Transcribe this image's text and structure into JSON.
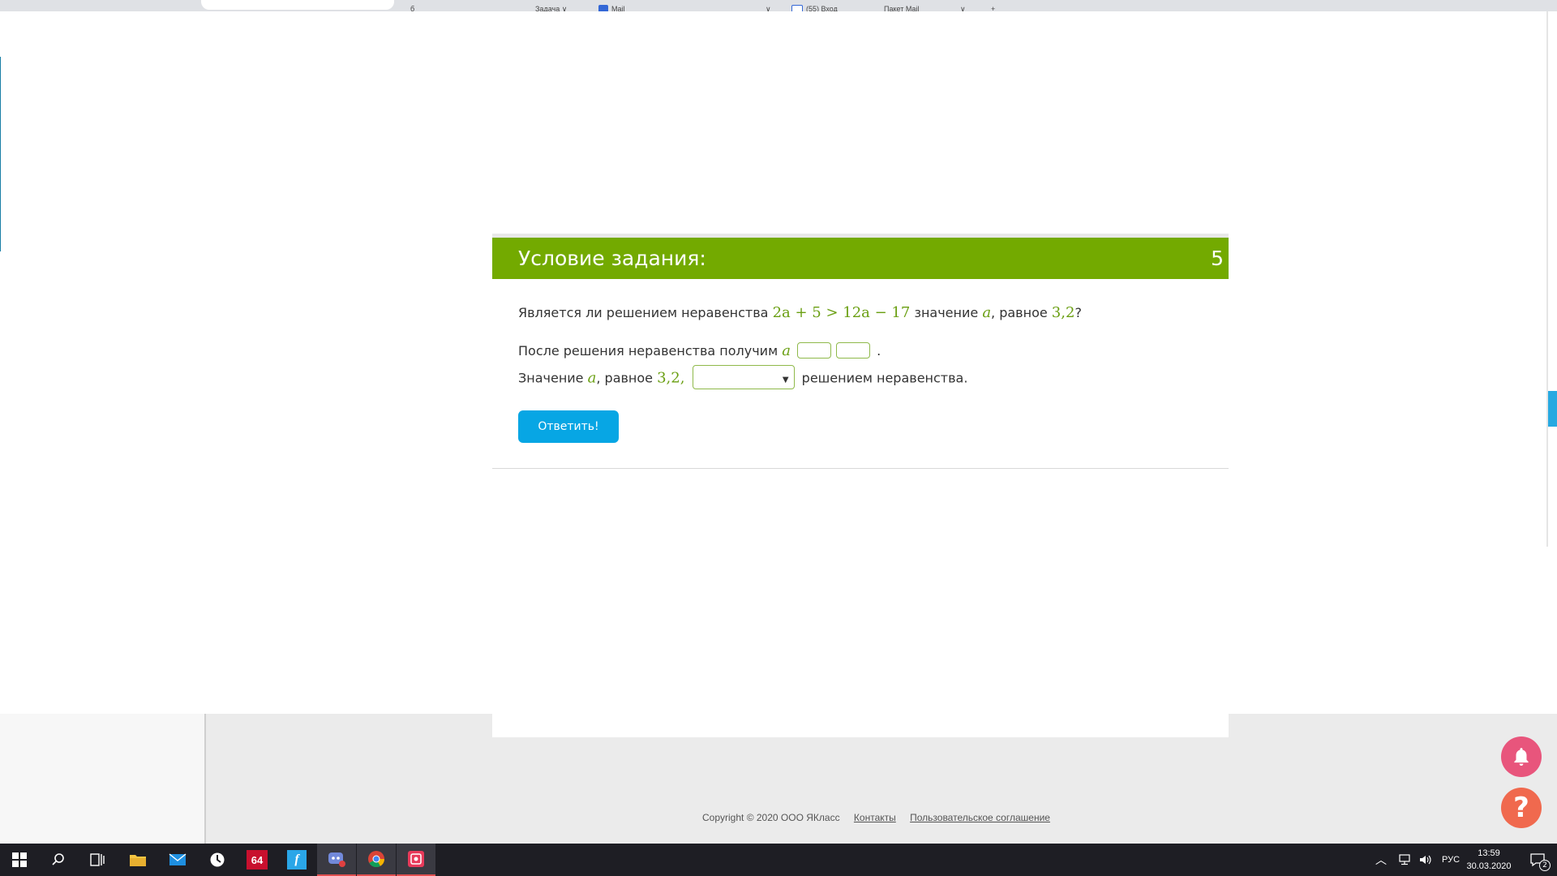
{
  "browser": {
    "tab_fragments": [
      "б",
      "Задача ∨",
      "Mail",
      "∨",
      "(55) Вход",
      "Пакет Mail",
      "∨",
      "+"
    ]
  },
  "task": {
    "header_title": "Условие задания:",
    "header_number": "5",
    "question": {
      "prefix": "Является ли решением неравенства",
      "inequality": "2a + 5 > 12a − 17",
      "middle": "значение",
      "var": "a",
      "equal_word": ", равное",
      "value": "3,2",
      "suffix": "?"
    },
    "line1": {
      "text": "После решения неравенства получим",
      "var": "a",
      "period": "."
    },
    "line2": {
      "prefix": "Значение",
      "var": "a",
      "equal_word": ", равное",
      "value": "3,2,",
      "suffix": "решением неравенства."
    },
    "submit_label": "Ответить!"
  },
  "footer": {
    "copyright": "Copyright © 2020 ООО ЯКласс",
    "contacts": "Контакты",
    "agreement": "Пользовательское соглашение"
  },
  "taskbar": {
    "badge_64": "64",
    "lang": "РУС",
    "time": "13:59",
    "date": "30.03.2020",
    "notif_count": "2"
  },
  "colors": {
    "header_green": "#73aa00",
    "math_green": "#6a9f12",
    "button_blue": "#07a6e4",
    "bell_pink": "#e8557c",
    "help_orange": "#f0694e"
  }
}
